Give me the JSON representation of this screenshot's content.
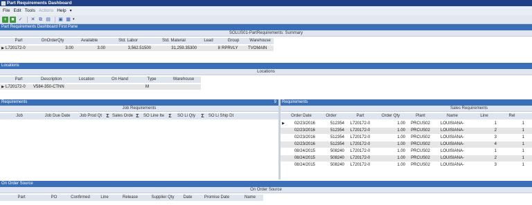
{
  "window": {
    "title": "Part Requirements Dashboard"
  },
  "menu": {
    "items": [
      {
        "label": "File",
        "enabled": true
      },
      {
        "label": "Edit",
        "enabled": true
      },
      {
        "label": "Tools",
        "enabled": true
      },
      {
        "label": "Actions",
        "enabled": false
      },
      {
        "label": "Help",
        "enabled": true
      }
    ]
  },
  "toolbar": {
    "icons": [
      "new-icon",
      "save-icon",
      "clear-icon",
      "delete-icon",
      "copy-icon",
      "paste-icon",
      "print-icon",
      "view-icon"
    ]
  },
  "first_pane": {
    "header": "Part Requirements Dashboard First Pane",
    "bar_title": "SOLUS01-PartRequirements: Summary",
    "columns": [
      "Part",
      "OnOrderQty",
      "Available",
      "Std. Labor",
      "Std. Material",
      "Lead",
      "Group",
      "Warehouse"
    ],
    "row": [
      "L720172-0",
      "3.00",
      "3.00",
      "3,562.51500",
      "31,259.35300",
      "8",
      "RPRVLY",
      "TVOMAIN"
    ]
  },
  "locations": {
    "header": "Locations",
    "bar_title": "Locations",
    "columns": [
      "Part",
      "Description",
      "Location",
      "On Hand",
      "Type",
      "Warehouse"
    ],
    "row": [
      "L720172-0",
      "V584-350-CTNN",
      "",
      "",
      "M",
      ""
    ]
  },
  "requirements_left": {
    "header": "Requirements",
    "pin": "9",
    "bar_title": "Job Requirements",
    "columns": [
      "Job",
      "Job Due Date",
      "Job Prod Qt",
      "Σ",
      "Sales Orde",
      "Σ",
      "SO Line Ite",
      "Σ",
      "SO Li Qty",
      "Σ",
      "SO Li Ship Dt"
    ]
  },
  "requirements_right": {
    "header": "Requirements",
    "bar_title": "Sales Requirements",
    "columns": [
      "Order Date",
      "Order",
      "Part",
      "Order Qty",
      "Plant",
      "Name",
      "Line",
      "Rel"
    ],
    "rows": [
      [
        "02/23/2016",
        "512354",
        "L720172-0",
        "1.00",
        "PRCUS02",
        "LOUISIANA-",
        "1",
        "1"
      ],
      [
        "02/23/2016",
        "512354",
        "L720172-0",
        "1.00",
        "PRCUS02",
        "LOUISIANA-",
        "2",
        "1"
      ],
      [
        "02/23/2016",
        "512354",
        "L720172-0",
        "1.00",
        "PRCUS02",
        "LOUISIANA-",
        "3",
        "1"
      ],
      [
        "02/23/2016",
        "512354",
        "L720172-0",
        "1.00",
        "PRCUS02",
        "LOUISIANA-",
        "4",
        "1"
      ],
      [
        "08/24/2015",
        "508240",
        "L720172-0",
        "1.00",
        "PRCUS02",
        "LOUISIANA-",
        "1",
        "1"
      ],
      [
        "08/24/2015",
        "508240",
        "L720172-0",
        "1.00",
        "PRCUS02",
        "LOUISIANA-",
        "2",
        "1"
      ],
      [
        "08/24/2015",
        "508240",
        "L720172-0",
        "1.00",
        "PRCUS02",
        "LOUISIANA-",
        "3",
        "1"
      ]
    ]
  },
  "on_order_source": {
    "header": "On Order Source",
    "bar_title": "On Order Source",
    "columns": [
      "Part",
      "PO",
      "Confirmed",
      "Line",
      "Release",
      "Supplier Qty",
      "Date",
      "Promise Date",
      "Name"
    ]
  },
  "colors": {
    "title_bar": "#1f3f86",
    "panel_header": "#3a6fb7",
    "grid_header": "#dfe5ee",
    "alt_row": "#e6e6e6"
  }
}
